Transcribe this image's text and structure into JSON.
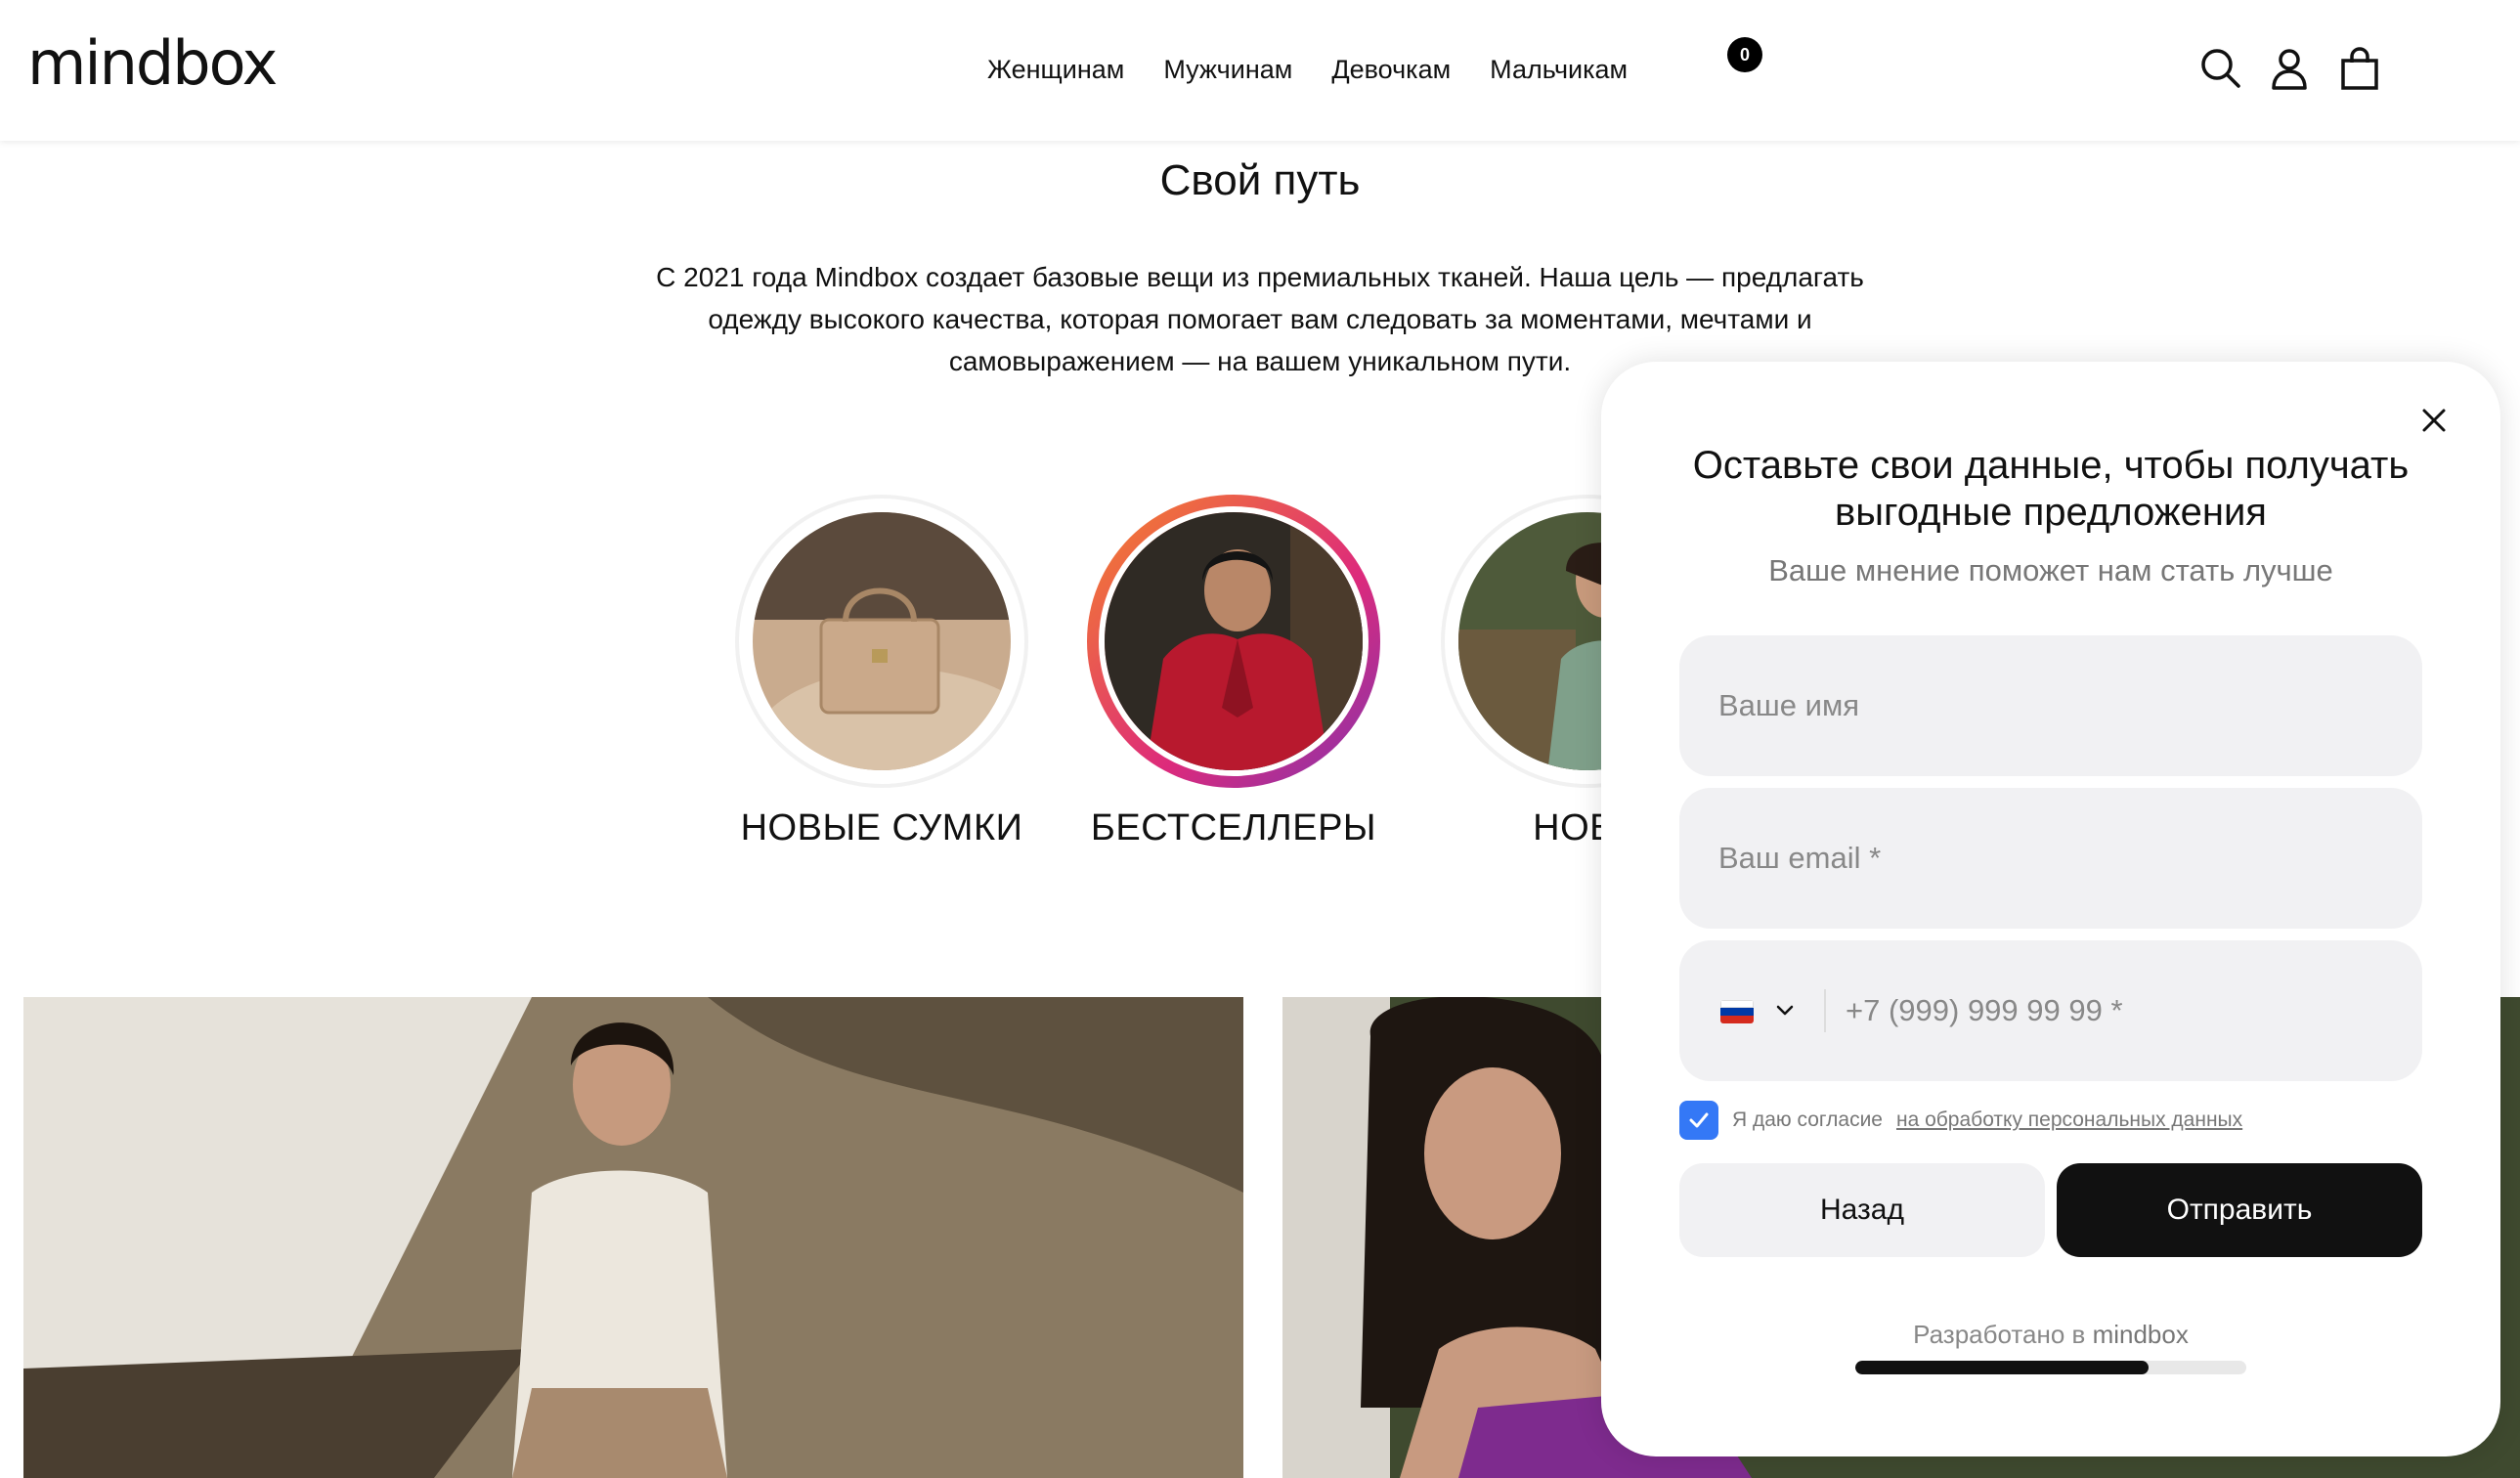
{
  "header": {
    "logo": "mindbox",
    "nav": [
      "Женщинам",
      "Мужчинам",
      "Девочкам",
      "Мальчикам"
    ],
    "cart_count": "0",
    "icons": [
      "search-icon",
      "user-icon",
      "cart-icon"
    ]
  },
  "intro": {
    "title": "Свой путь",
    "text": "С 2021 года Mindbox создает базовые вещи из премиальных тканей. Наша цель — предлагать одежду высокого качества, которая помогает вам следовать за моментами, мечтами и самовыражением — на вашем уникальном пути."
  },
  "stories": [
    {
      "label": "НОВЫЕ СУМКИ",
      "active": false
    },
    {
      "label": "БЕСТСЕЛЛЕРЫ",
      "active": true
    },
    {
      "label": "НОВИ",
      "active": false
    }
  ],
  "popup": {
    "title": "Оставьте свои данные, чтобы получать выгодные предложения",
    "subtitle": "Ваше мнение поможет нам стать лучше",
    "name_placeholder": "Ваше имя",
    "email_placeholder": "Ваш email *",
    "phone_placeholder": "+7 (999) 999 99 99 *",
    "consent_text": "Я даю согласие",
    "consent_link": "на обработку персональных данных",
    "consent_checked": true,
    "back_label": "Назад",
    "submit_label": "Отправить",
    "powered_prefix": "Разработано в",
    "powered_brand": "mindbox",
    "progress_fraction": 0.75
  },
  "colors": {
    "checkbox": "#3478f6",
    "submit_bg": "#111111",
    "field_bg": "#f1f1f3"
  }
}
